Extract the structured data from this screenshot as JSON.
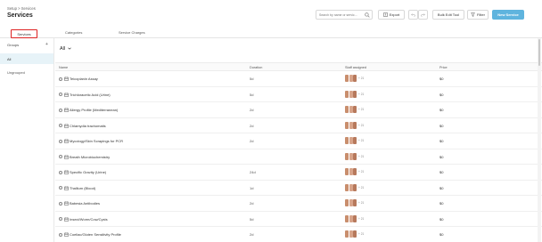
{
  "header": {
    "breadcrumb": [
      "Setup",
      ">",
      "Services"
    ],
    "title": "Services",
    "search_placeholder": "Search by name or servic...",
    "export_label": "Export",
    "bulk_edit_label": "Bulk Edit Tool",
    "filter_label": "Filter",
    "new_service_label": "New Service"
  },
  "tabs": [
    {
      "label": "Services",
      "active": true
    },
    {
      "label": "Categories"
    },
    {
      "label": "Service Charges"
    }
  ],
  "sidebar": {
    "title": "Groups",
    "add_symbol": "+",
    "items": [
      {
        "label": "All",
        "selected": true
      },
      {
        "label": "Ungrouped"
      }
    ]
  },
  "main": {
    "filter_value": "All",
    "columns": [
      "Name",
      "Duration",
      "Staff assigned",
      "Price"
    ],
    "rows": [
      {
        "name": "Teicoplanin Assay",
        "duration": "5d",
        "staff_more": "+ 21",
        "price": "$0"
      },
      {
        "name": "Trichloracetic Acid (Urine)",
        "duration": "5d",
        "staff_more": "+ 21",
        "price": "$0"
      },
      {
        "name": "Allergy Profile (Mediterranean)",
        "duration": "2d",
        "staff_more": "+ 21",
        "price": "$0"
      },
      {
        "name": "Chlamydia trachomatis",
        "duration": "2d",
        "staff_more": "+ 21",
        "price": "$0"
      },
      {
        "name": "Mycology/Skin Scrapings for PCR",
        "duration": "2d",
        "staff_more": "+ 21",
        "price": "$0"
      },
      {
        "name": "Breath Microbiochemistry",
        "duration": "",
        "staff_more": "+ 21",
        "price": "$0"
      },
      {
        "name": "Specific Gravity (Urine)",
        "duration": "24d",
        "staff_more": "+ 21",
        "price": "$0"
      },
      {
        "name": "Thallium (Blood)",
        "duration": "1d",
        "staff_more": "+ 21",
        "price": "$0"
      },
      {
        "name": "Babesia Antibodies",
        "duration": "2d",
        "staff_more": "+ 21",
        "price": "$0"
      },
      {
        "name": "Insect/Worm/Cow/Cysts",
        "duration": "5d",
        "staff_more": "+ 21",
        "price": "$0"
      },
      {
        "name": "Coeliac/Gluten Sensitivity Profile",
        "duration": "2d",
        "staff_more": "+ 21",
        "price": "$0"
      }
    ]
  },
  "colors": {
    "accent": "#5fb4de",
    "selected_bg": "#e7f3f8",
    "active_tab_border": "#dd2222"
  }
}
